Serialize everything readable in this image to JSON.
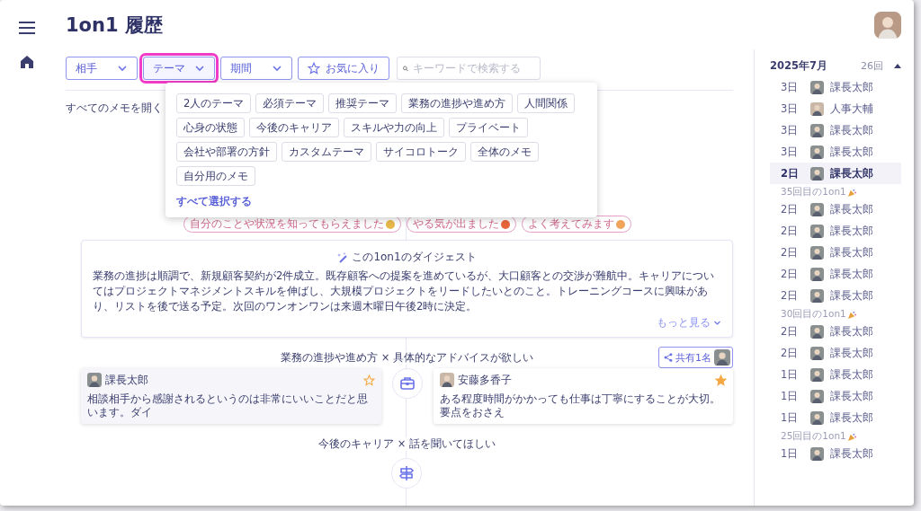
{
  "page": {
    "title": "1on1 履歴"
  },
  "filters": [
    {
      "kind": "dropdown",
      "label": "相手",
      "highlighted": false
    },
    {
      "kind": "dropdown",
      "label": "テーマ",
      "highlighted": true
    },
    {
      "kind": "dropdown",
      "label": "期間",
      "highlighted": false
    },
    {
      "kind": "favorite",
      "label": "お気に入り",
      "highlighted": false
    }
  ],
  "search": {
    "placeholder": "キーワードで検索する"
  },
  "open_all_link": "すべてのメモを開く",
  "theme_dropdown": {
    "chips": [
      "2人のテーマ",
      "必須テーマ",
      "推奨テーマ",
      "業務の進捗や進め方",
      "人間関係",
      "心身の状態",
      "今後のキャリア",
      "スキルや力の向上",
      "プライベート",
      "会社や部署の方針",
      "カスタムテーマ",
      "サイコロトーク",
      "全体のメモ",
      "自分用のメモ"
    ],
    "select_all": "すべて選択する"
  },
  "reactions": [
    {
      "label": "自分のことや状況を知ってもらえました",
      "color": "#e8b84a"
    },
    {
      "label": "やる気が出ました",
      "color": "#e8673a"
    },
    {
      "label": "よく考えてみます",
      "color": "#f0a35a"
    }
  ],
  "digest": {
    "title": "この1on1のダイジェスト",
    "body": "業務の進捗は順調で、新規顧客契約が2件成立。既存顧客への提案を進めているが、大口顧客との交渉が難航中。キャリアについてはプロジェクトマネジメントスキルを伸ばし、大規模プロジェクトをリードしたいとのこと。トレーニングコースに興味があり、リストを後で送る予定。次回のワンオンワンは来週木曜日午後2時に決定。",
    "more": "もっと見る"
  },
  "topics": [
    {
      "label": "業務の進捗や進め方 × 具体的なアドバイスが欲しい",
      "share": "共有1名",
      "notes": [
        {
          "author": "課長太郎",
          "text": "相談相手から感謝されるというのは非常にいいことだと思います。ダイ",
          "starred": false
        },
        {
          "author": "安藤多香子",
          "text": "ある程度時間がかかっても仕事は丁寧にすることが大切。要点をおさえ",
          "starred": true
        }
      ]
    },
    {
      "label": "今後のキャリア × 話を聞いてほしい"
    }
  ],
  "history": {
    "month": "2025年7月",
    "count": "26回",
    "expanded": true,
    "items": [
      {
        "kind": "row",
        "day": "3日",
        "name": "課長太郎",
        "selected": false
      },
      {
        "kind": "row",
        "day": "3日",
        "name": "人事大輔",
        "selected": false
      },
      {
        "kind": "row",
        "day": "3日",
        "name": "課長太郎",
        "selected": false
      },
      {
        "kind": "row",
        "day": "3日",
        "name": "課長太郎",
        "selected": false
      },
      {
        "kind": "row",
        "day": "2日",
        "name": "課長太郎",
        "selected": true
      },
      {
        "kind": "milestone",
        "label": "35回目の1on1"
      },
      {
        "kind": "row",
        "day": "2日",
        "name": "課長太郎",
        "selected": false
      },
      {
        "kind": "row",
        "day": "2日",
        "name": "課長太郎",
        "selected": false
      },
      {
        "kind": "row",
        "day": "2日",
        "name": "課長太郎",
        "selected": false
      },
      {
        "kind": "row",
        "day": "2日",
        "name": "課長太郎",
        "selected": false
      },
      {
        "kind": "row",
        "day": "2日",
        "name": "課長太郎",
        "selected": false
      },
      {
        "kind": "milestone",
        "label": "30回目の1on1"
      },
      {
        "kind": "row",
        "day": "2日",
        "name": "課長太郎",
        "selected": false
      },
      {
        "kind": "row",
        "day": "2日",
        "name": "課長太郎",
        "selected": false
      },
      {
        "kind": "row",
        "day": "1日",
        "name": "課長太郎",
        "selected": false
      },
      {
        "kind": "row",
        "day": "1日",
        "name": "課長太郎",
        "selected": false
      },
      {
        "kind": "row",
        "day": "1日",
        "name": "課長太郎",
        "selected": false
      },
      {
        "kind": "milestone",
        "label": "25回目の1on1"
      },
      {
        "kind": "row",
        "day": "1日",
        "name": "課長太郎",
        "selected": false
      }
    ]
  }
}
